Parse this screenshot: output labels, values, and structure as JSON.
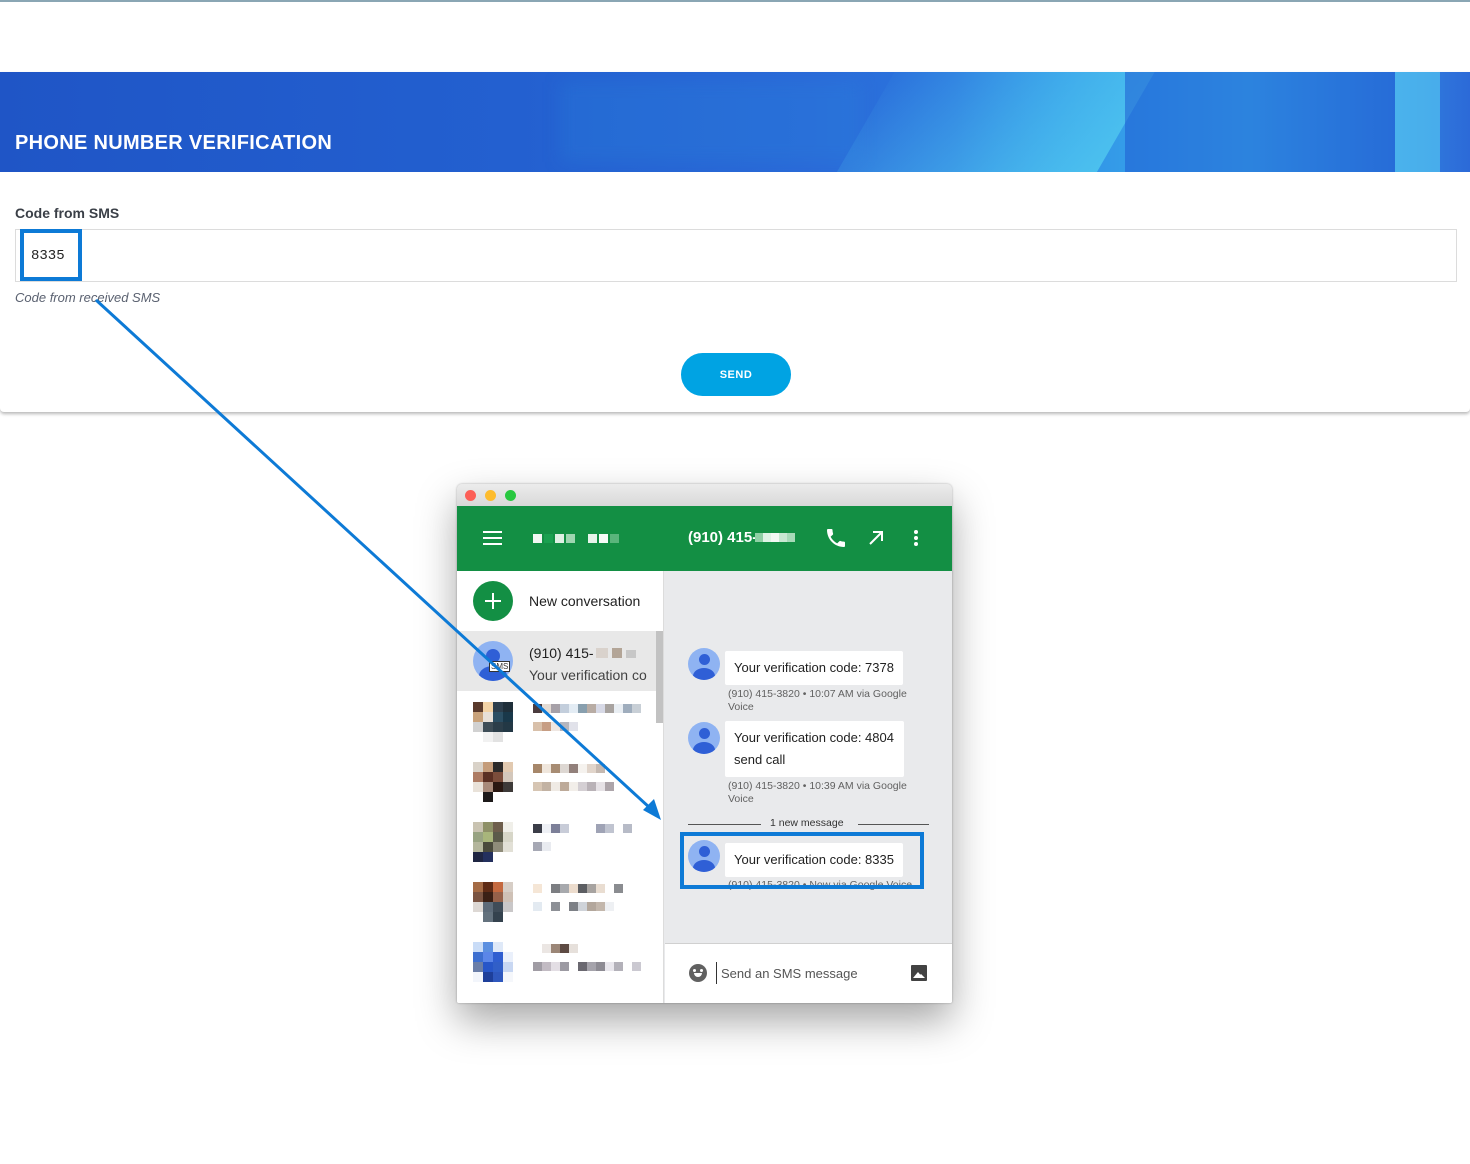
{
  "verification": {
    "title": "PHONE NUMBER VERIFICATION",
    "field_label": "Code from SMS",
    "code_value": "8335",
    "hint": "Code from received SMS",
    "send_label": "SEND"
  },
  "voice_app": {
    "header_phone": "(910) 415-",
    "new_conversation_label": "New conversation",
    "active_conversation": {
      "name": "(910) 415-",
      "snippet": "Your verification co",
      "badge": "SMS"
    },
    "messages": [
      {
        "text": "Your verification code: 7378",
        "meta": "(910) 415-3820 • 10:07 AM  via Google Voice"
      },
      {
        "text": "Your verification code: 4804",
        "extra": "send call",
        "meta": "(910) 415-3820 • 10:39 AM  via Google Voice"
      },
      {
        "text": "Your verification code: 8335",
        "meta": "(910) 415-3820 • Now via Google Voice"
      }
    ],
    "new_message_divider": "1 new message",
    "composer_placeholder": "Send an SMS message"
  },
  "icons": {
    "menu": "menu-icon",
    "phone": "phone-icon",
    "popout": "popout-arrow-icon",
    "more": "more-vert-icon",
    "emoji": "emoji-icon",
    "image": "image-icon",
    "add": "plus-icon",
    "avatar": "person-avatar-icon"
  },
  "colors": {
    "banner_blue": "#2360d0",
    "accent_cyan": "#00a3e3",
    "voice_green": "#138f44",
    "highlight_blue": "#0d7ad6"
  }
}
